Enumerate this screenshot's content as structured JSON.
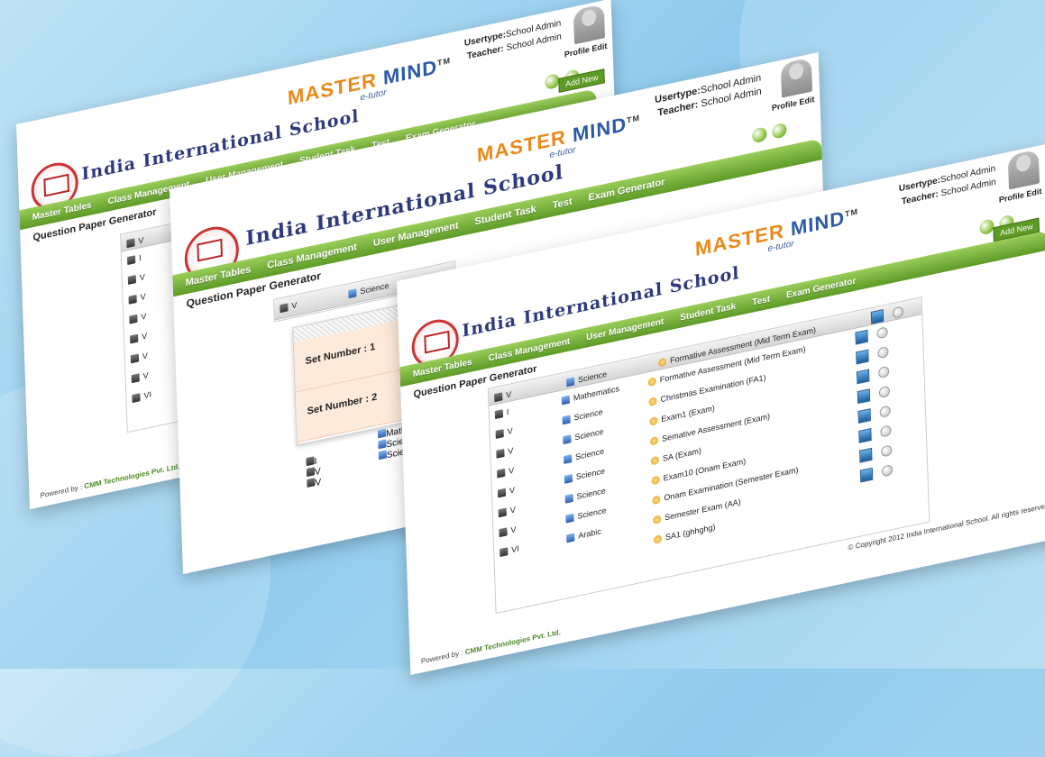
{
  "window": {
    "school_name": "India International School",
    "brand": {
      "word1": "MASTER",
      "word2": "MIND",
      "tm": "TM",
      "tagline": "e-tutor"
    },
    "usertype_label": "Usertype:",
    "usertype_value": "School Admin",
    "teacher_label": "Teacher:",
    "teacher_value": "School Admin",
    "profile_edit": "Profile Edit",
    "add_new": "Add New",
    "nav": [
      "Master Tables",
      "Class Management",
      "User Management",
      "Student Task",
      "Test",
      "Exam Generator"
    ],
    "page_title": "Question Paper Generator",
    "powered_by_label": "Powered by :",
    "powered_by_company": "CMM Technologies Pvt. Ltd.",
    "copyright": "© Copyright 2012 India International School. All rights reserved."
  },
  "table": {
    "header": {
      "class": "V",
      "subject": "Science",
      "exam": "Formative Assessment (Mid Term Exam)"
    },
    "rows": [
      {
        "class": "I",
        "subject": "Mathematics",
        "exam": "Formative Assessment (Mid Term Exam)"
      },
      {
        "class": "V",
        "subject": "Science",
        "exam": "Christmas Examination (FA1)"
      },
      {
        "class": "V",
        "subject": "Science",
        "exam": "Exam1 (Exam)"
      },
      {
        "class": "V",
        "subject": "Science",
        "exam": "Semative Assessment (Exam)"
      },
      {
        "class": "V",
        "subject": "Science",
        "exam": "SA (Exam)"
      },
      {
        "class": "V",
        "subject": "Science",
        "exam": "Exam10 (Onam Exam)"
      },
      {
        "class": "V",
        "subject": "Science",
        "exam": "Onam Examination (Semester Exam)"
      },
      {
        "class": "VI",
        "subject": "Arabic",
        "exam": "Semester Exam (AA)"
      },
      {
        "class": "",
        "subject": "",
        "exam": "SA1 (ghhghg)"
      }
    ]
  },
  "set_popup": {
    "sets": [
      "Set Number : 1",
      "Set Number : 2"
    ]
  },
  "middle_rows": [
    {
      "class": "I",
      "subject": "Mathematics"
    },
    {
      "class": "V",
      "subject": "Science"
    },
    {
      "class": "V",
      "subject": "Science"
    }
  ],
  "colors": {
    "nav_green": "#5d9b26",
    "title_blue": "#2e3a7c",
    "brand_orange": "#e88a1a"
  }
}
